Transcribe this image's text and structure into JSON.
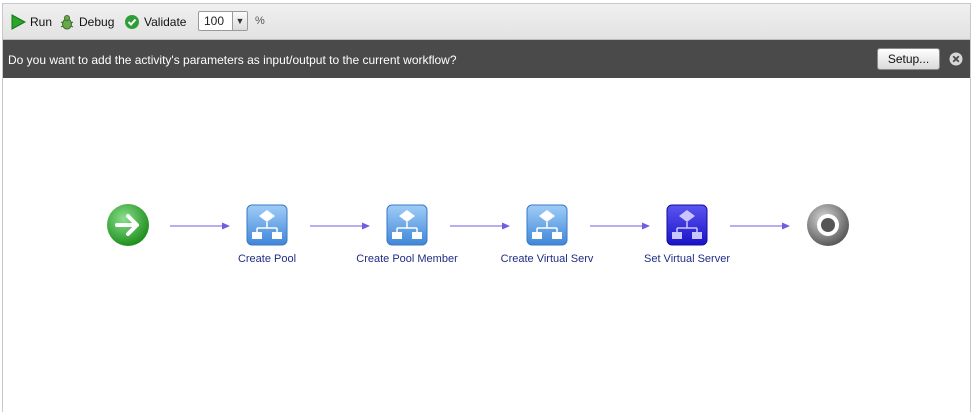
{
  "toolbar": {
    "run_label": "Run",
    "debug_label": "Debug",
    "validate_label": "Validate",
    "zoom_value": "100",
    "zoom_unit": "%"
  },
  "banner": {
    "message": "Do you want to add the activity's parameters as input/output to the current workflow?",
    "setup_label": "Setup..."
  },
  "workflow": {
    "start_icon": "start-arrow-icon",
    "end_icon": "end-target-icon",
    "nodes": [
      {
        "label": "Create Pool",
        "icon": "activity-icon",
        "state": "normal"
      },
      {
        "label": "Create Pool Member",
        "icon": "activity-icon",
        "state": "normal"
      },
      {
        "label": "Create Virtual Serv",
        "icon": "activity-icon",
        "state": "normal"
      },
      {
        "label": "Set Virtual Server",
        "icon": "activity-icon",
        "state": "selected"
      }
    ]
  },
  "colors": {
    "banner_bg": "#4a4a4a",
    "connector": "#6f5fe0",
    "node_normal": "#5a9de6",
    "node_selected": "#2b22e0",
    "start": "#35b035",
    "label": "#1f2d86"
  }
}
